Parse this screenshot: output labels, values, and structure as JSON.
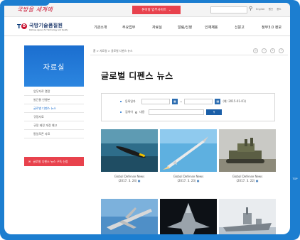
{
  "top": {
    "slogan": "국방을 세계에",
    "site_select": "본아랑 업무사이트",
    "site_select_arrow": "⌄",
    "util_links": [
      "English",
      "웹진",
      "풍도"
    ]
  },
  "header": {
    "logo_kr": "국방기술품질원",
    "logo_en": "Defense Agency for Technology and Quality",
    "nav": [
      "기관소개",
      "주요업무",
      "자료실",
      "알림/신청",
      "인재채용",
      "신문고",
      "정부3.0 정보"
    ]
  },
  "sidebar": {
    "title": "자료실",
    "items": [
      "업무자료 열람",
      "발간물 안행본",
      "글로벌 디펜스 뉴스",
      "규정자료",
      "규정 제정 개정 예고",
      "통일모존 자료"
    ],
    "banner": "글로벌 디펜스 뉴스 구독 신청"
  },
  "breadcrumb": "홈 > 자료실 > 글로벌 디펜스 뉴스",
  "page_title": "글로벌 디펜스 뉴스",
  "search": {
    "period_label": "등록일자",
    "period_sep": "~",
    "period_hint": "(예: 2015-01-01)",
    "keyword_label": "검색어",
    "radio_label": "내용",
    "search_icon": "magnifier-icon"
  },
  "gallery": [
    {
      "title": "Global Defense News",
      "date": "(2017. 3. 24)"
    },
    {
      "title": "Global Defense News",
      "date": "(2017. 3. 23)"
    },
    {
      "title": "Global Defense News",
      "date": "(2017. 3. 22)"
    },
    {
      "title": "",
      "date": ""
    },
    {
      "title": "",
      "date": ""
    },
    {
      "title": "",
      "date": ""
    }
  ],
  "side_tab": "TOP",
  "colors": {
    "frame": "#1c7ed0",
    "accent_red": "#e8424d",
    "brand_blue": "#1b6ecf"
  }
}
